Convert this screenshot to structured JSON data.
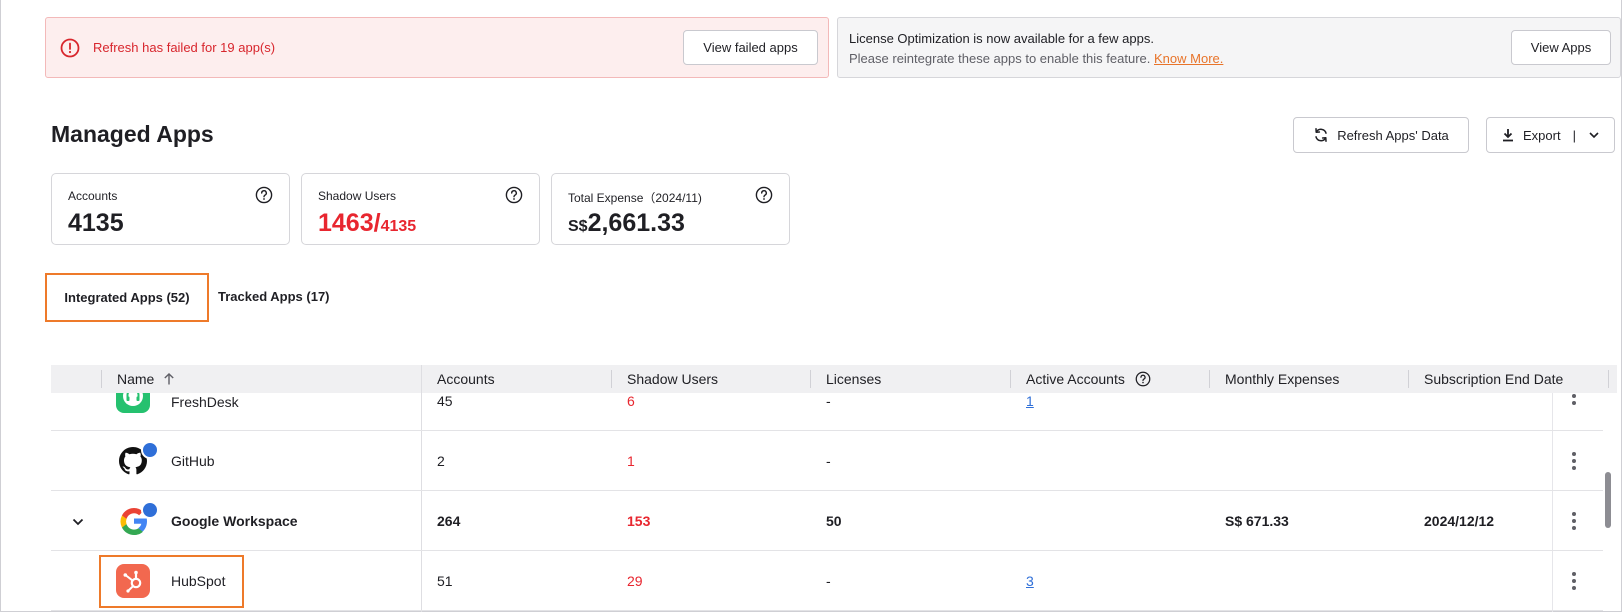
{
  "error_banner": {
    "text": "Refresh has failed for 19 app(s)",
    "button": "View failed apps"
  },
  "info_banner": {
    "line1": "License Optimization is now available for a few apps.",
    "line2": "Please reintegrate these apps to enable this feature.",
    "link": "Know More.",
    "button": "View Apps"
  },
  "header": {
    "title": "Managed Apps",
    "refresh_label": "Refresh Apps' Data",
    "export_label": "Export",
    "export_sep": "|"
  },
  "cards": {
    "accounts": {
      "label": "Accounts",
      "value": "4135"
    },
    "shadow": {
      "label": "Shadow Users",
      "value": "1463/",
      "total": "4135"
    },
    "expense": {
      "label": "Total Expense（2024/11)",
      "prefix": "S$",
      "value": "2,661.33"
    }
  },
  "tabs": {
    "integrated": "Integrated Apps (52)",
    "tracked": "Tracked Apps (17)"
  },
  "table": {
    "headers": {
      "name": "Name",
      "accounts": "Accounts",
      "shadow": "Shadow Users",
      "licenses": "Licenses",
      "active": "Active Accounts",
      "monthly": "Monthly Expenses",
      "subscription": "Subscription End Date"
    },
    "rows": [
      {
        "name": "FreshDesk",
        "accounts": "45",
        "shadow": "6",
        "licenses": "-",
        "active": "1",
        "monthly": "",
        "end": ""
      },
      {
        "name": "GitHub",
        "accounts": "2",
        "shadow": "1",
        "licenses": "-",
        "active": "",
        "monthly": "",
        "end": ""
      },
      {
        "name": "Google Workspace",
        "accounts": "264",
        "shadow": "153",
        "licenses": "50",
        "active": "",
        "monthly": "S$ 671.33",
        "end": "2024/12/12"
      },
      {
        "name": "HubSpot",
        "accounts": "51",
        "shadow": "29",
        "licenses": "-",
        "active": "3",
        "monthly": "",
        "end": ""
      }
    ]
  },
  "colors": {
    "accent_orange": "#ee7a2a",
    "error_red": "#e8262f",
    "link_blue": "#2f6fd8"
  },
  "icons": [
    "alert-circle-icon",
    "refresh-icon",
    "download-icon",
    "chevron-down-icon",
    "help-icon",
    "sort-up-icon",
    "kebab-icon",
    "freshdesk-logo",
    "github-logo",
    "google-logo",
    "hubspot-logo"
  ]
}
